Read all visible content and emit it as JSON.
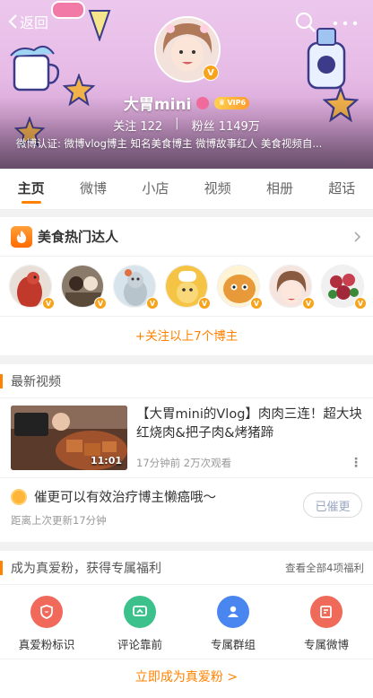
{
  "header": {
    "back_label": "返回",
    "name": "大胃mini",
    "vip_label": "VIP6",
    "following_label": "关注",
    "following_count": "122",
    "followers_label": "粉丝",
    "followers_count": "1149万",
    "certification": "微博认证: 微博vlog博主 知名美食博主 微博故事红人 美食视频自..."
  },
  "tabs": [
    "主页",
    "微博",
    "小店",
    "视频",
    "相册",
    "超话"
  ],
  "experts": {
    "title": "美食热门达人",
    "follow_all": "+关注以上7个博主",
    "avatars": [
      "#c0392b",
      "#6b5a4a",
      "#a8b8c8",
      "#f0c040",
      "#e8a040",
      "#f3d7cf",
      "#b03040"
    ]
  },
  "videos": {
    "section_title": "最新视频",
    "item": {
      "title": "【大胃mini的Vlog】肉肉三连！超大块红烧肉&把子肉&烤猪蹄",
      "duration": "11:01",
      "meta": "17分钟前  2万次观看",
      "more": "⋮"
    },
    "urge": {
      "text": "催更可以有效治疗博主懒癌哦～",
      "sub": "距离上次更新17分钟",
      "button": "已催更"
    }
  },
  "fans": {
    "title": "成为真爱粉，获得专属福利",
    "view_all": "查看全部4项福利",
    "benefits": [
      {
        "label": "真爱粉标识",
        "color": "#f0695a"
      },
      {
        "label": "评论靠前",
        "color": "#3cc08c"
      },
      {
        "label": "专属群组",
        "color": "#4a86f0"
      },
      {
        "label": "专属微博",
        "color": "#f06a5a"
      }
    ],
    "join": "立即成为真爱粉 >"
  }
}
